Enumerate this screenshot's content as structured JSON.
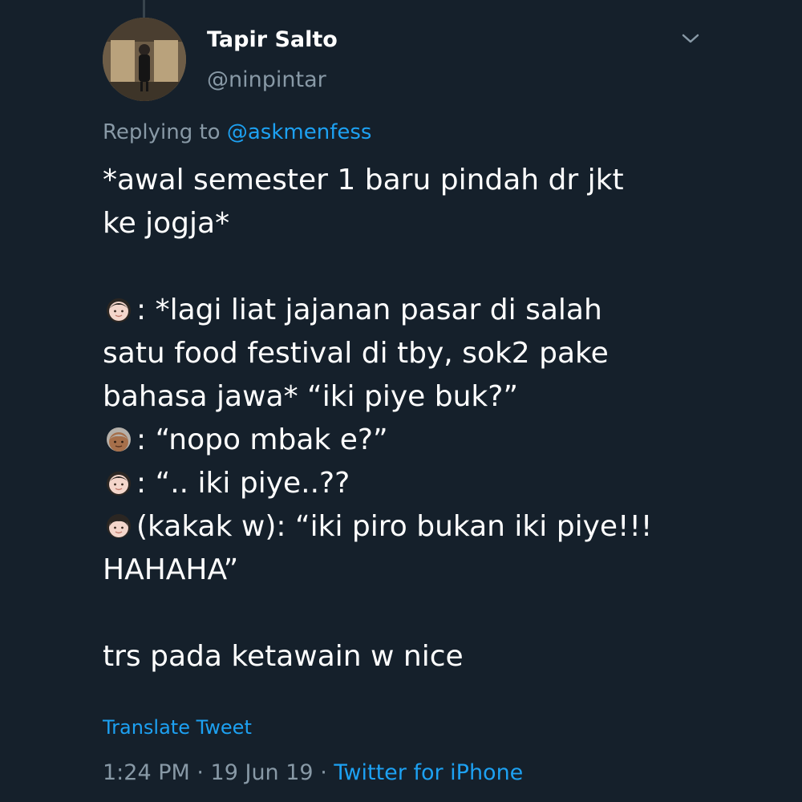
{
  "author": {
    "display_name": "Tapir Salto",
    "handle": "@ninpintar"
  },
  "reply": {
    "prefix": "Replying to",
    "mention": "@askmenfess"
  },
  "tweet": {
    "line1": "*awal semester 1 baru pindah dr jkt",
    "line2": "ke jogja*",
    "line3_text": ": *lagi liat jajanan pasar di salah",
    "line4": "satu food festival di tby, sok2 pake",
    "line5": "bahasa jawa* “iki piye buk?”",
    "line6_text": ": “nopo mbak e?”",
    "line7_text": ": “.. iki piye..??",
    "line8_text": "(kakak w): “iki piro bukan iki piye!!!",
    "line9": "HAHAHA”",
    "line10": "trs pada ketawain w nice",
    "emojis": [
      "girl-emoji",
      "old-woman-emoji",
      "girl-emoji",
      "woman-emoji"
    ]
  },
  "actions": {
    "translate_label": "Translate Tweet"
  },
  "meta": {
    "time": "1:24 PM",
    "sep1": " · ",
    "date": "19 Jun 19",
    "sep2": " · ",
    "source": "Twitter for iPhone"
  },
  "colors": {
    "background": "#15202b",
    "text": "#ffffff",
    "secondary": "#8899a6",
    "accent": "#1da1f2"
  }
}
